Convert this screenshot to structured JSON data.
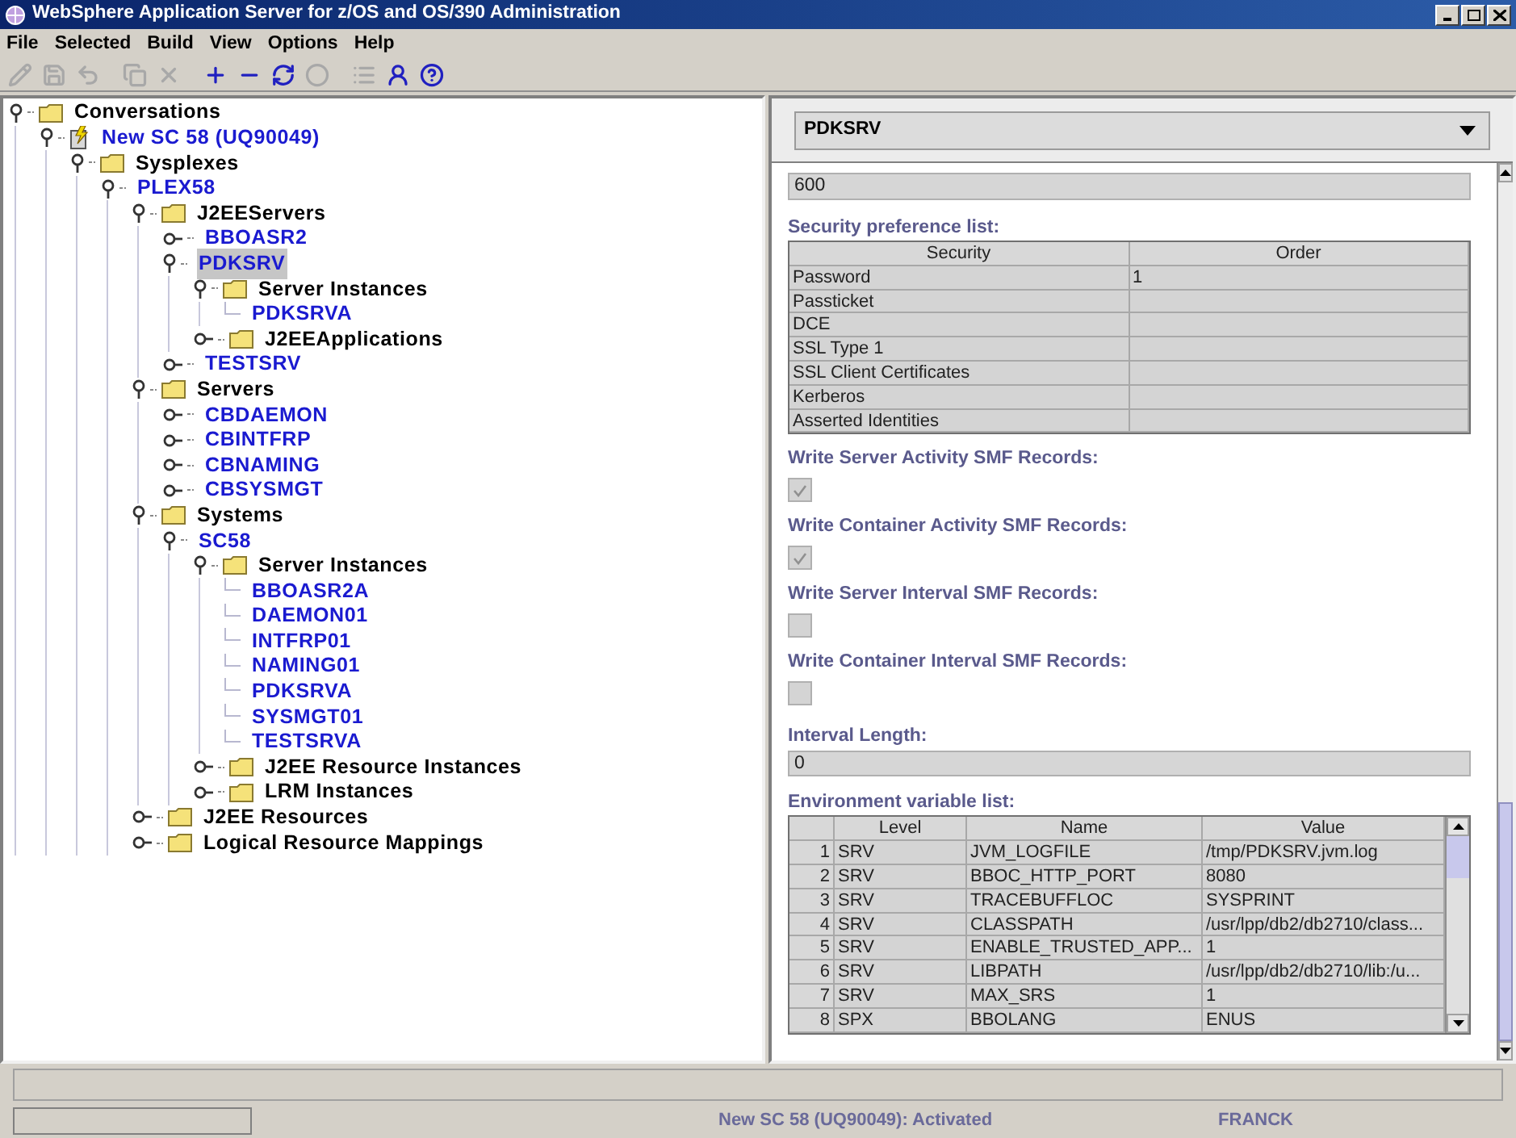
{
  "window": {
    "title": "WebSphere Application Server for z/OS and OS/390 Administration"
  },
  "menu": [
    "File",
    "Selected",
    "Build",
    "View",
    "Options",
    "Help"
  ],
  "tree": [
    {
      "label": "Conversations",
      "kind": "folder",
      "expanded": true,
      "selected": false,
      "children": [
        {
          "label": "New SC 58 (UQ90049)",
          "kind": "conversation",
          "expanded": true,
          "selected": false,
          "children": [
            {
              "label": "Sysplexes",
              "kind": "folder",
              "expanded": true,
              "selected": false,
              "children": [
                {
                  "label": "PLEX58",
                  "kind": "object",
                  "expanded": true,
                  "selected": false,
                  "children": [
                    {
                      "label": "J2EEServers",
                      "kind": "folder",
                      "expanded": true,
                      "selected": false,
                      "children": [
                        {
                          "label": "BBOASR2",
                          "kind": "object",
                          "expanded": false,
                          "selected": false
                        },
                        {
                          "label": "PDKSRV",
                          "kind": "object",
                          "expanded": true,
                          "selected": true,
                          "children": [
                            {
                              "label": "Server Instances",
                              "kind": "folder",
                              "expanded": true,
                              "selected": false,
                              "children": [
                                {
                                  "label": "PDKSRVA",
                                  "kind": "object",
                                  "selected": false
                                }
                              ]
                            },
                            {
                              "label": "J2EEApplications",
                              "kind": "folder",
                              "expanded": false,
                              "selected": false
                            }
                          ]
                        },
                        {
                          "label": "TESTSRV",
                          "kind": "object",
                          "expanded": false,
                          "selected": false
                        }
                      ]
                    },
                    {
                      "label": "Servers",
                      "kind": "folder",
                      "expanded": true,
                      "selected": false,
                      "children": [
                        {
                          "label": "CBDAEMON",
                          "kind": "object",
                          "expanded": false,
                          "selected": false
                        },
                        {
                          "label": "CBINTFRP",
                          "kind": "object",
                          "expanded": false,
                          "selected": false
                        },
                        {
                          "label": "CBNAMING",
                          "kind": "object",
                          "expanded": false,
                          "selected": false
                        },
                        {
                          "label": "CBSYSMGT",
                          "kind": "object",
                          "expanded": false,
                          "selected": false
                        }
                      ]
                    },
                    {
                      "label": "Systems",
                      "kind": "folder",
                      "expanded": true,
                      "selected": false,
                      "children": [
                        {
                          "label": "SC58",
                          "kind": "object",
                          "expanded": true,
                          "selected": false,
                          "children": [
                            {
                              "label": "Server Instances",
                              "kind": "folder",
                              "expanded": true,
                              "selected": false,
                              "children": [
                                {
                                  "label": "BBOASR2A",
                                  "kind": "object",
                                  "selected": false
                                },
                                {
                                  "label": "DAEMON01",
                                  "kind": "object",
                                  "selected": false
                                },
                                {
                                  "label": "INTFRP01",
                                  "kind": "object",
                                  "selected": false
                                },
                                {
                                  "label": "NAMING01",
                                  "kind": "object",
                                  "selected": false
                                },
                                {
                                  "label": "PDKSRVA",
                                  "kind": "object",
                                  "selected": false
                                },
                                {
                                  "label": "SYSMGT01",
                                  "kind": "object",
                                  "selected": false
                                },
                                {
                                  "label": "TESTSRVA",
                                  "kind": "object",
                                  "selected": false
                                }
                              ]
                            },
                            {
                              "label": "J2EE Resource Instances",
                              "kind": "folder",
                              "expanded": false,
                              "selected": false
                            },
                            {
                              "label": "LRM Instances",
                              "kind": "folder",
                              "expanded": false,
                              "selected": false
                            }
                          ]
                        }
                      ]
                    },
                    {
                      "label": "J2EE Resources",
                      "kind": "folder",
                      "expanded": false,
                      "selected": false
                    },
                    {
                      "label": "Logical Resource Mappings",
                      "kind": "folder",
                      "expanded": false,
                      "selected": false
                    }
                  ]
                }
              ]
            }
          ]
        }
      ]
    }
  ],
  "detail": {
    "selector": "PDKSRV",
    "ssl_timeout_value": "600",
    "security_label": "Security preference list:",
    "security_table": {
      "columns": [
        "Security",
        "Order"
      ],
      "rows": [
        [
          "Password",
          "1"
        ],
        [
          "Passticket",
          ""
        ],
        [
          "DCE",
          ""
        ],
        [
          "SSL Type 1",
          ""
        ],
        [
          "SSL Client Certificates",
          ""
        ],
        [
          "Kerberos",
          ""
        ],
        [
          "Asserted Identities",
          ""
        ]
      ]
    },
    "checkboxes": [
      {
        "label": "Write Server Activity SMF Records:",
        "checked": true
      },
      {
        "label": "Write Container Activity SMF Records:",
        "checked": true
      },
      {
        "label": "Write Server Interval SMF Records:",
        "checked": false
      },
      {
        "label": "Write Container Interval SMF Records:",
        "checked": false
      }
    ],
    "interval_label": "Interval Length:",
    "interval_value": "0",
    "env_label": "Environment variable list:",
    "env_table": {
      "columns": [
        "Level",
        "Name",
        "Value"
      ],
      "rows": [
        {
          "index": "1",
          "cells": [
            "SRV",
            "JVM_LOGFILE",
            "/tmp/PDKSRV.jvm.log"
          ]
        },
        {
          "index": "2",
          "cells": [
            "SRV",
            "BBOC_HTTP_PORT",
            "8080"
          ]
        },
        {
          "index": "3",
          "cells": [
            "SRV",
            "TRACEBUFFLOC",
            "SYSPRINT"
          ]
        },
        {
          "index": "4",
          "cells": [
            "SRV",
            "CLASSPATH",
            "/usr/lpp/db2/db2710/class..."
          ]
        },
        {
          "index": "5",
          "cells": [
            "SRV",
            "ENABLE_TRUSTED_APP...",
            "1"
          ]
        },
        {
          "index": "6",
          "cells": [
            "SRV",
            "LIBPATH",
            "/usr/lpp/db2/db2710/lib:/u..."
          ]
        },
        {
          "index": "7",
          "cells": [
            "SRV",
            "MAX_SRS",
            "1"
          ]
        },
        {
          "index": "8",
          "cells": [
            "SPX",
            "BBOLANG",
            "ENUS"
          ]
        }
      ]
    }
  },
  "status_bar": {
    "message": "New SC 58 (UQ90049): Activated",
    "user": "FRANCK"
  }
}
